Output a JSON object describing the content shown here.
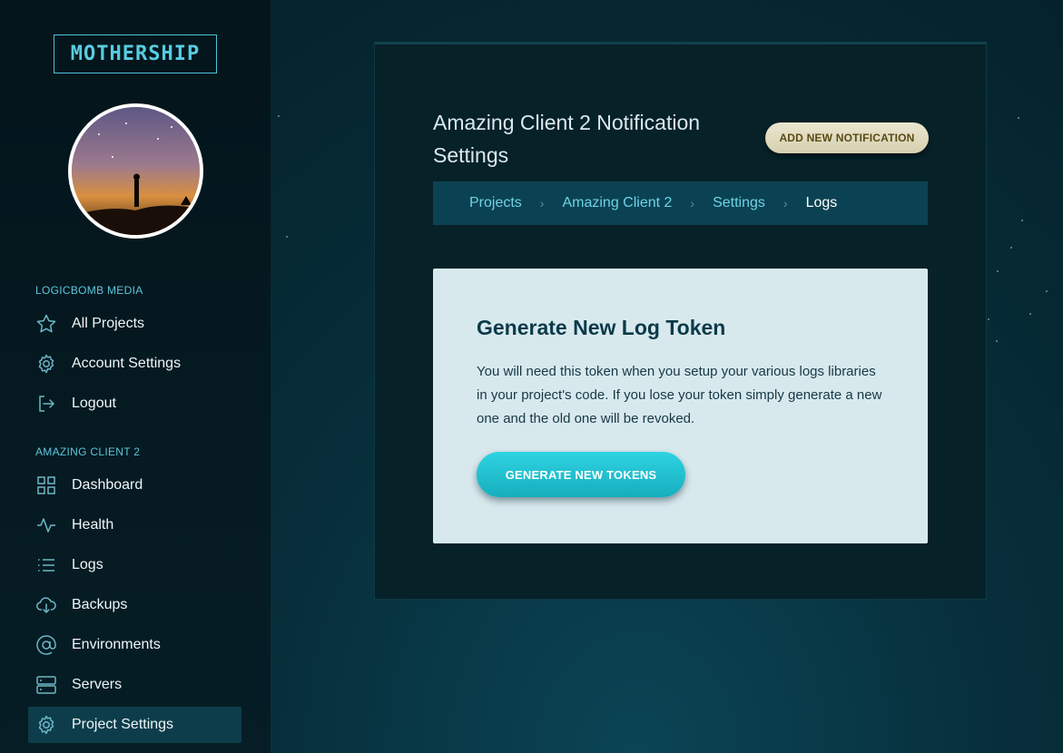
{
  "brand": {
    "logo_text": "MOTHERSHIP"
  },
  "sidebar": {
    "section_org": "LOGICBOMB MEDIA",
    "org_items": [
      {
        "label": "All Projects",
        "icon": "star-icon"
      },
      {
        "label": "Account Settings",
        "icon": "gear-icon"
      },
      {
        "label": "Logout",
        "icon": "logout-icon"
      }
    ],
    "section_project": "AMAZING CLIENT 2",
    "project_items": [
      {
        "label": "Dashboard",
        "icon": "grid-icon"
      },
      {
        "label": "Health",
        "icon": "pulse-icon"
      },
      {
        "label": "Logs",
        "icon": "list-icon"
      },
      {
        "label": "Backups",
        "icon": "cloud-download-icon"
      },
      {
        "label": "Environments",
        "icon": "at-icon"
      },
      {
        "label": "Servers",
        "icon": "server-icon"
      },
      {
        "label": "Project Settings",
        "icon": "gear-icon",
        "active": true
      }
    ]
  },
  "header": {
    "title": "Amazing Client 2 Notification Settings",
    "add_button": "ADD NEW NOTIFICATION"
  },
  "breadcrumb": [
    "Projects",
    "Amazing Client 2",
    "Settings",
    "Logs"
  ],
  "card": {
    "title": "Generate New Log Token",
    "text": "You will need this token when you setup your various logs libraries in your project's code. If you lose your token simply generate a new one and the old one will be revoked.",
    "button": "GENERATE NEW TOKENS"
  },
  "colors": {
    "accent": "#58cde2",
    "primary_button": "#22c3d3",
    "secondary_button": "#e0dbbd",
    "sidebar_active": "#0d3d4b"
  }
}
